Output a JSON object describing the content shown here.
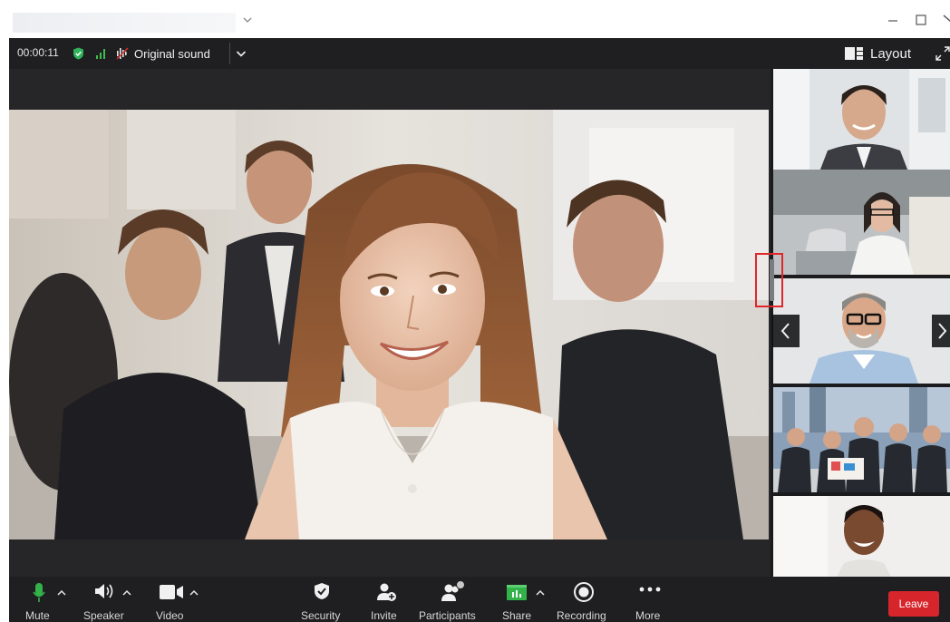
{
  "window": {
    "title": "",
    "controls": [
      "minimize-icon",
      "maximize-icon",
      "close-icon"
    ]
  },
  "topbar": {
    "timer": "00:00:11",
    "status_icons": [
      "shield-check-icon",
      "signal-bars-icon"
    ],
    "audio_mode_label": "Original sound",
    "layout_label": "Layout",
    "colors": {
      "background": "#1f1f21",
      "shield": "#2fb35a",
      "signal": "#3fbf4a"
    }
  },
  "stage": {
    "main_speaker_icon": "main-speaker-video",
    "participant_tiles": 5,
    "strip_nav": [
      "chevron-left-icon",
      "chevron-right-icon"
    ]
  },
  "toolbar": {
    "mute_label": "Mute",
    "speaker_label": "Speaker",
    "video_label": "Video",
    "security_label": "Security",
    "invite_label": "Invite",
    "participants_label": "Participants",
    "share_label": "Share",
    "recording_label": "Recording",
    "more_label": "More",
    "leave_label": "Leave",
    "colors": {
      "mic": "#34b24a",
      "share": "#34b24a",
      "leave": "#d7252c"
    }
  }
}
